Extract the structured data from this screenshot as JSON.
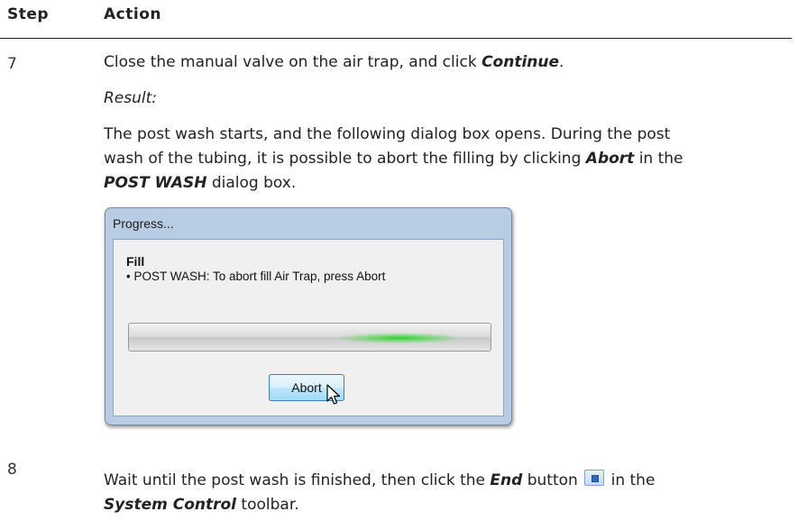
{
  "header": {
    "step": "Step",
    "action": "Action"
  },
  "step7": {
    "number": "7",
    "line1_pre": "Close the manual valve on the air trap, and click ",
    "line1_bold": "Continue",
    "line1_post": ".",
    "result_label": "Result:",
    "para_a": "The post wash starts, and the following dialog box opens. During the post",
    "para_b_pre": "wash of the tubing, it is possible to abort the filling by clicking ",
    "para_b_bold": "Abort",
    "para_b_post": " in the",
    "para_c_bold": "POST WASH",
    "para_c_post": " dialog box."
  },
  "dialog": {
    "title": "Progress...",
    "heading": "Fill",
    "message": "• POST WASH: To abort fill Air Trap, press Abort",
    "button_label": "Abort",
    "progress_indicator": "indeterminate",
    "glow_color": "#22cc22"
  },
  "step8": {
    "number": "8",
    "line1_pre": "Wait until the post wash is finished, then click the ",
    "line1_bold": "End",
    "line1_mid": " button",
    "line1_post": " in the",
    "line2_bold": "System Control",
    "line2_post": " toolbar.",
    "end_icon": "stop-square-icon"
  }
}
